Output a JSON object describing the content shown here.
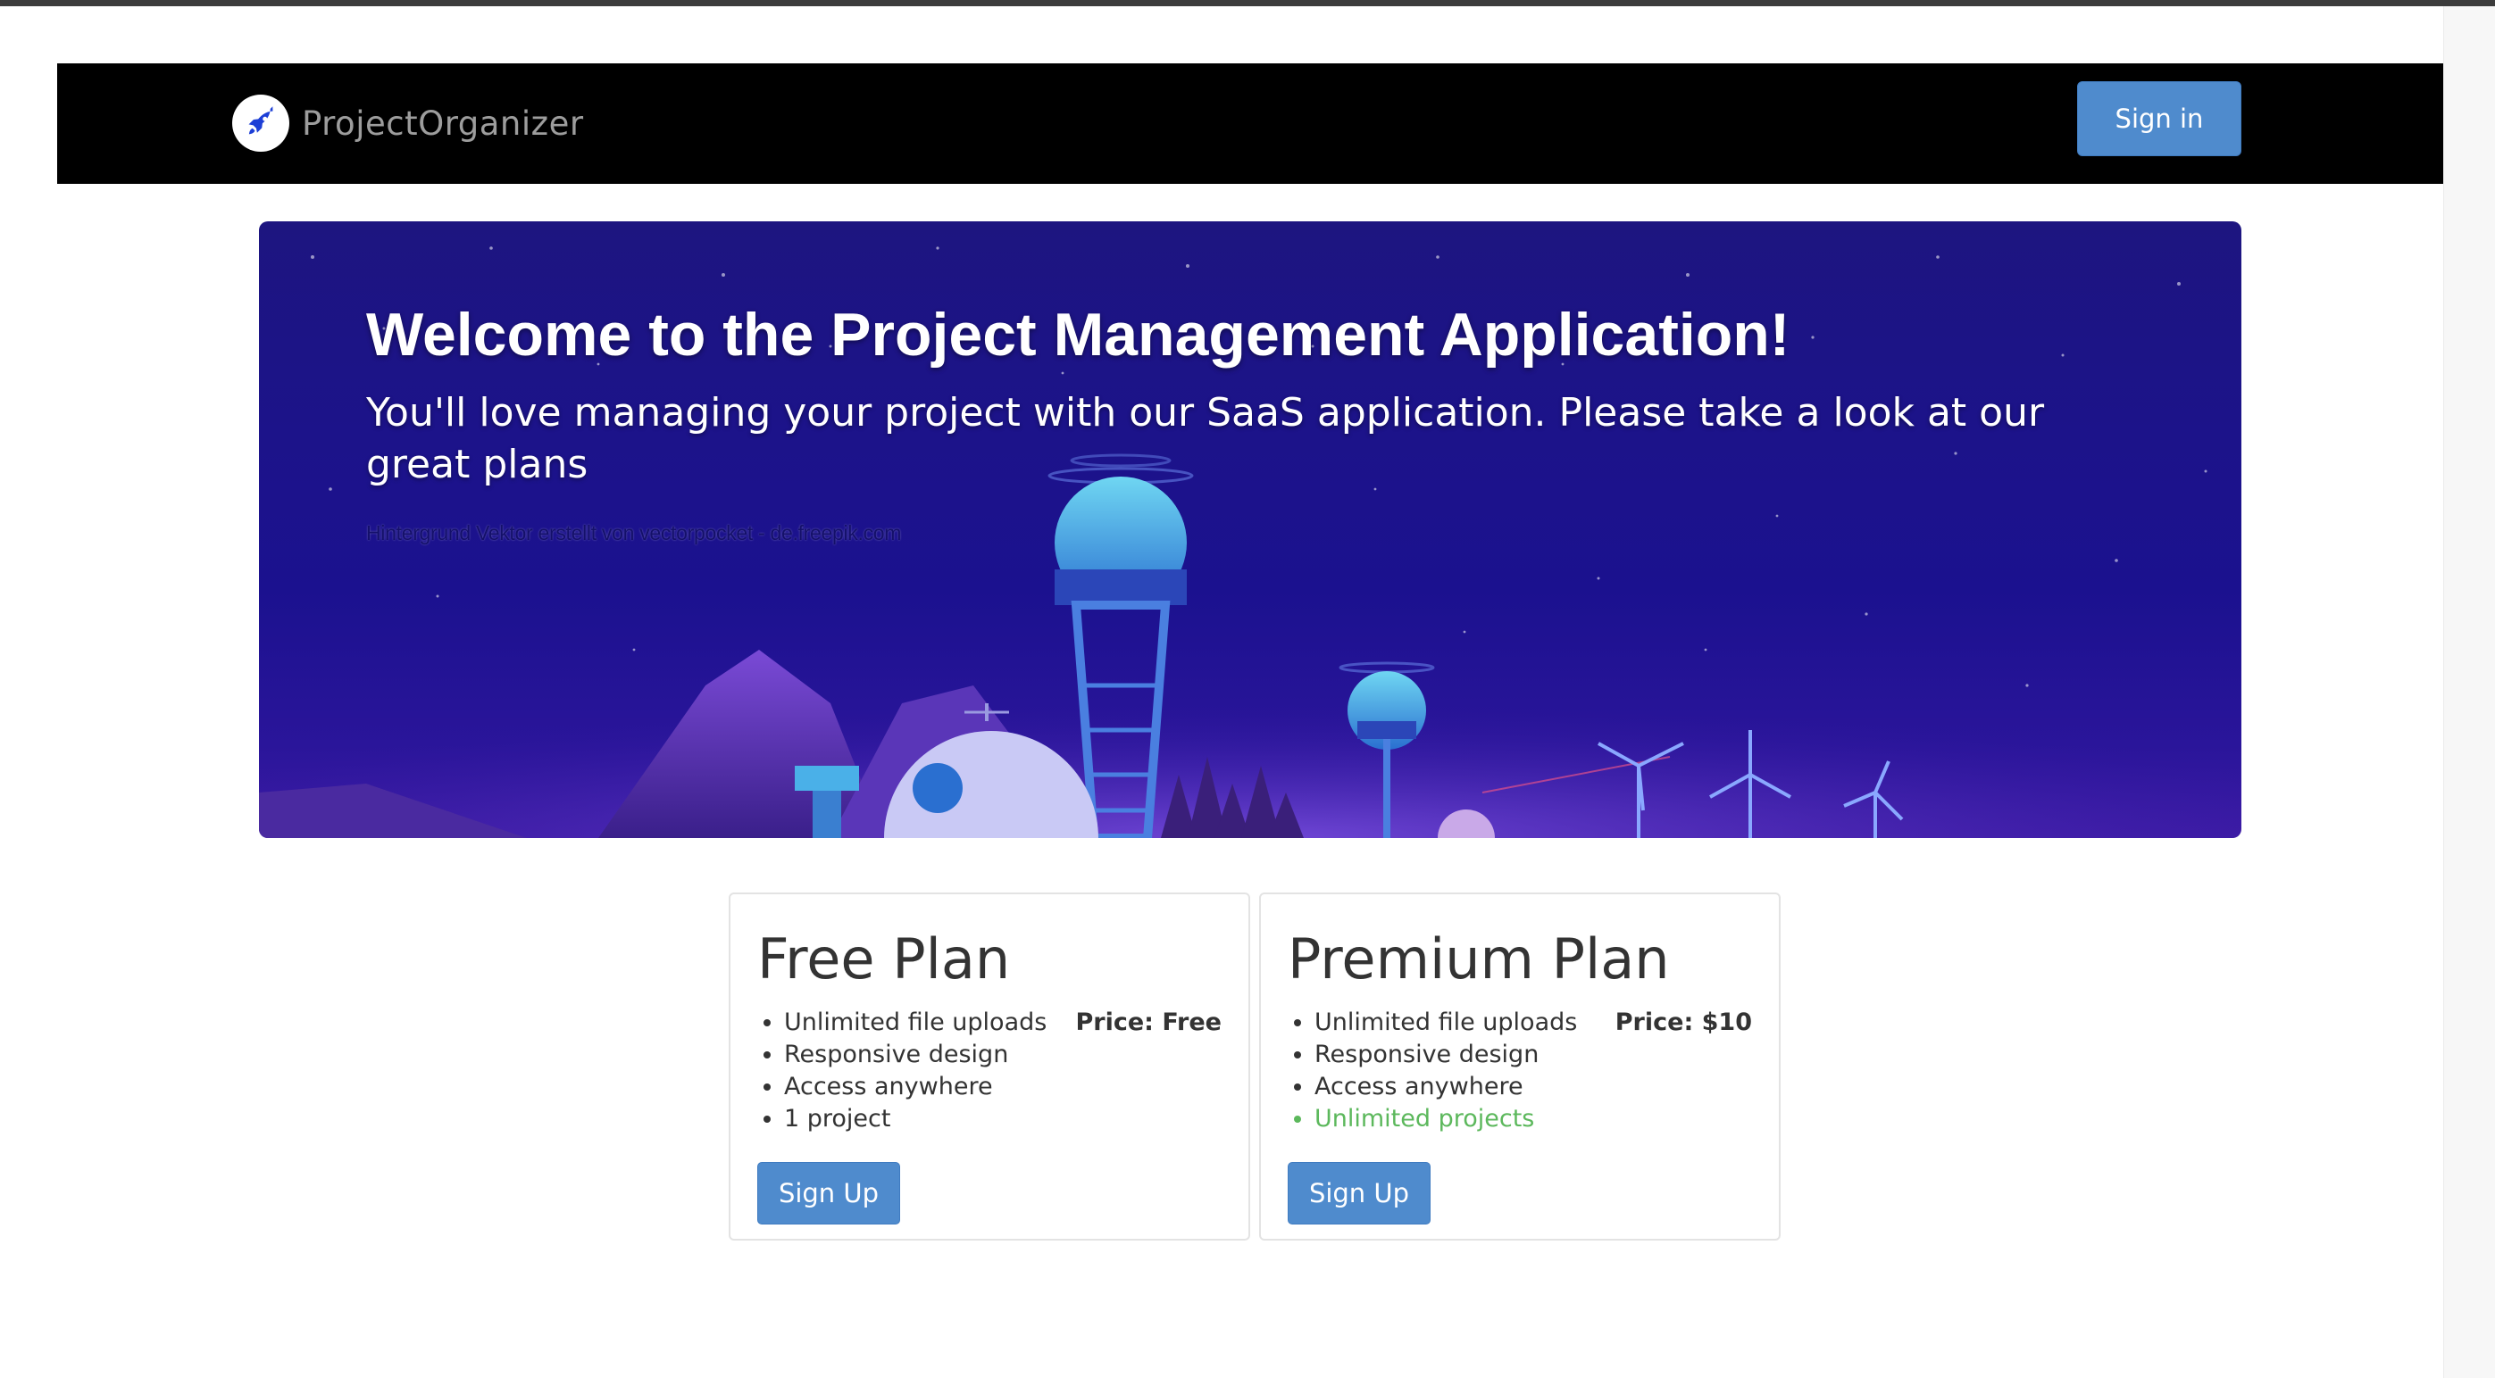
{
  "navbar": {
    "brand_name": "ProjectOrganizer",
    "brand_icon": "rocket-icon",
    "signin_label": "Sign in",
    "background": "#000000"
  },
  "hero": {
    "title": "Welcome to the Project Management Application!",
    "subtitle": "You'll love managing your project with our SaaS application. Please take a look at our great plans",
    "credit": "Hintergrund Vektor erstellt von vectorpocket - de.freepik.com"
  },
  "plans": [
    {
      "title": "Free Plan",
      "price": "Price: Free",
      "features": [
        "Unlimited file uploads",
        "Responsive design",
        "Access anywhere",
        "1 project"
      ],
      "signup_label": "Sign Up"
    },
    {
      "title": "Premium Plan",
      "price": "Price: $10",
      "features": [
        "Unlimited file uploads",
        "Responsive design",
        "Access anywhere",
        "Unlimited projects"
      ],
      "signup_label": "Sign Up"
    }
  ],
  "colors": {
    "primary_button": "#4f8bcd",
    "highlight_feature": "#5cb85c",
    "hero_background": "#1c138a"
  }
}
